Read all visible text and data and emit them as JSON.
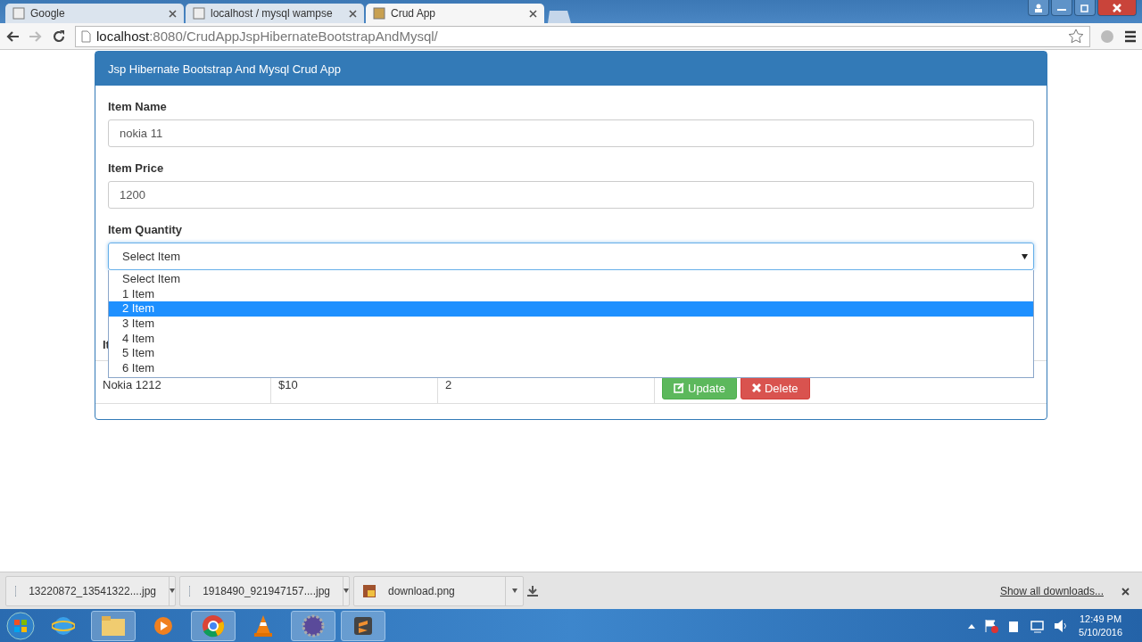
{
  "browser": {
    "tabs": [
      {
        "title": "Google",
        "selected": false
      },
      {
        "title": "localhost / mysql wampse",
        "selected": false
      },
      {
        "title": "Crud App",
        "selected": true
      }
    ],
    "address": {
      "host": "localhost",
      "path": ":8080/CrudAppJspHibernateBootstrapAndMysql/"
    }
  },
  "panel": {
    "title": "Jsp Hibernate Bootstrap And Mysql Crud App",
    "fields": [
      {
        "kind": "text",
        "label": "Item Name",
        "value": "nokia 11"
      },
      {
        "kind": "text",
        "label": "Item Price",
        "value": "1200"
      },
      {
        "kind": "select",
        "label": "Item Quantity",
        "value": "Select Item",
        "open": true,
        "options": [
          {
            "label": "Select Item",
            "highlighted": false
          },
          {
            "label": "1 Item",
            "highlighted": false
          },
          {
            "label": "2 Item",
            "highlighted": true
          },
          {
            "label": "3 Item",
            "highlighted": false
          },
          {
            "label": "4 Item",
            "highlighted": false
          },
          {
            "label": "5 Item",
            "highlighted": false
          },
          {
            "label": "6 Item",
            "highlighted": false
          }
        ]
      }
    ],
    "table": {
      "column_1": "It",
      "rows": [
        {
          "cells": [
            "Nokia 1212",
            "$10",
            "2"
          ],
          "actions": [
            {
              "kind": "update",
              "label": "Update"
            },
            {
              "kind": "delete",
              "label": "Delete"
            }
          ]
        }
      ]
    }
  },
  "downloads": {
    "items": [
      {
        "kind": "image",
        "name": "13220872_13541322....jpg"
      },
      {
        "kind": "image",
        "name": "1918490_921947157....jpg"
      },
      {
        "kind": "png",
        "name": "download.png"
      }
    ],
    "show_all": "Show all downloads..."
  },
  "taskbar": {
    "time": "12:49 PM",
    "date": "5/10/2016"
  }
}
